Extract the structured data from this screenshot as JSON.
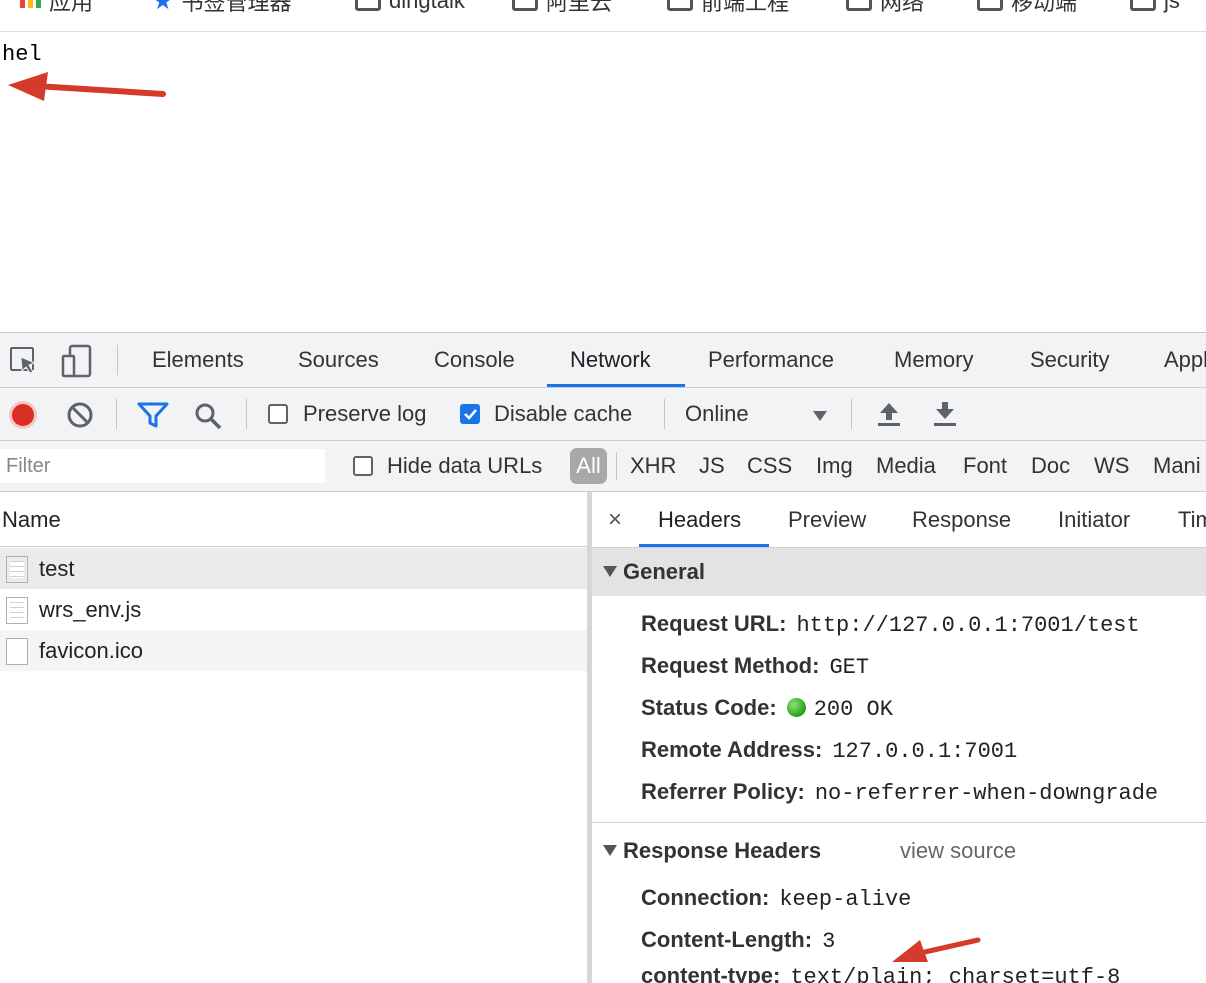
{
  "bookmarks": [
    {
      "label": "应用",
      "icon": "apps-grid-icon"
    },
    {
      "label": "书签管理器",
      "icon": "star-icon"
    },
    {
      "label": "dingtalk",
      "icon": "folder-icon"
    },
    {
      "label": "阿里云",
      "icon": "folder-icon"
    },
    {
      "label": "前端工程",
      "icon": "folder-icon"
    },
    {
      "label": "网络",
      "icon": "folder-icon"
    },
    {
      "label": "移动端",
      "icon": "folder-icon"
    },
    {
      "label": "js",
      "icon": "folder-icon"
    }
  ],
  "page": {
    "body_text": "hel"
  },
  "devtools": {
    "tabs": [
      "Elements",
      "Sources",
      "Console",
      "Network",
      "Performance",
      "Memory",
      "Security",
      "Appl"
    ],
    "active_tab": "Network",
    "toolbar": {
      "preserve_log": {
        "label": "Preserve log",
        "checked": false
      },
      "disable_cache": {
        "label": "Disable cache",
        "checked": true
      },
      "throttle": "Online"
    },
    "filter": {
      "placeholder": "Filter",
      "hide_data_urls": {
        "label": "Hide data URLs",
        "checked": false
      },
      "types": [
        "All",
        "XHR",
        "JS",
        "CSS",
        "Img",
        "Media",
        "Font",
        "Doc",
        "WS",
        "Mani"
      ]
    },
    "request_list": {
      "header": "Name",
      "rows": [
        {
          "name": "test",
          "selected": true
        },
        {
          "name": "wrs_env.js",
          "selected": false
        },
        {
          "name": "favicon.ico",
          "selected": false
        }
      ]
    },
    "details": {
      "close_label": "×",
      "tabs": [
        "Headers",
        "Preview",
        "Response",
        "Initiator",
        "Tim"
      ],
      "active_tab": "Headers",
      "general": {
        "title": "General",
        "items": [
          {
            "key": "Request URL:",
            "value": "http://127.0.0.1:7001/test"
          },
          {
            "key": "Request Method:",
            "value": "GET"
          },
          {
            "key": "Status Code:",
            "value": "200 OK"
          },
          {
            "key": "Remote Address:",
            "value": "127.0.0.1:7001"
          },
          {
            "key": "Referrer Policy:",
            "value": "no-referrer-when-downgrade"
          }
        ]
      },
      "response_headers": {
        "title": "Response Headers",
        "view_source": "view source",
        "items": [
          {
            "key": "Connection:",
            "value": "keep-alive"
          },
          {
            "key": "Content-Length:",
            "value": "3"
          },
          {
            "key": "content-type:",
            "value": "text/plain; charset=utf-8"
          }
        ]
      }
    }
  },
  "colors": {
    "accent": "#1a73e8",
    "record": "#d93025",
    "annotation_arrow": "#d43b2a",
    "status_ok": "#24a015"
  }
}
